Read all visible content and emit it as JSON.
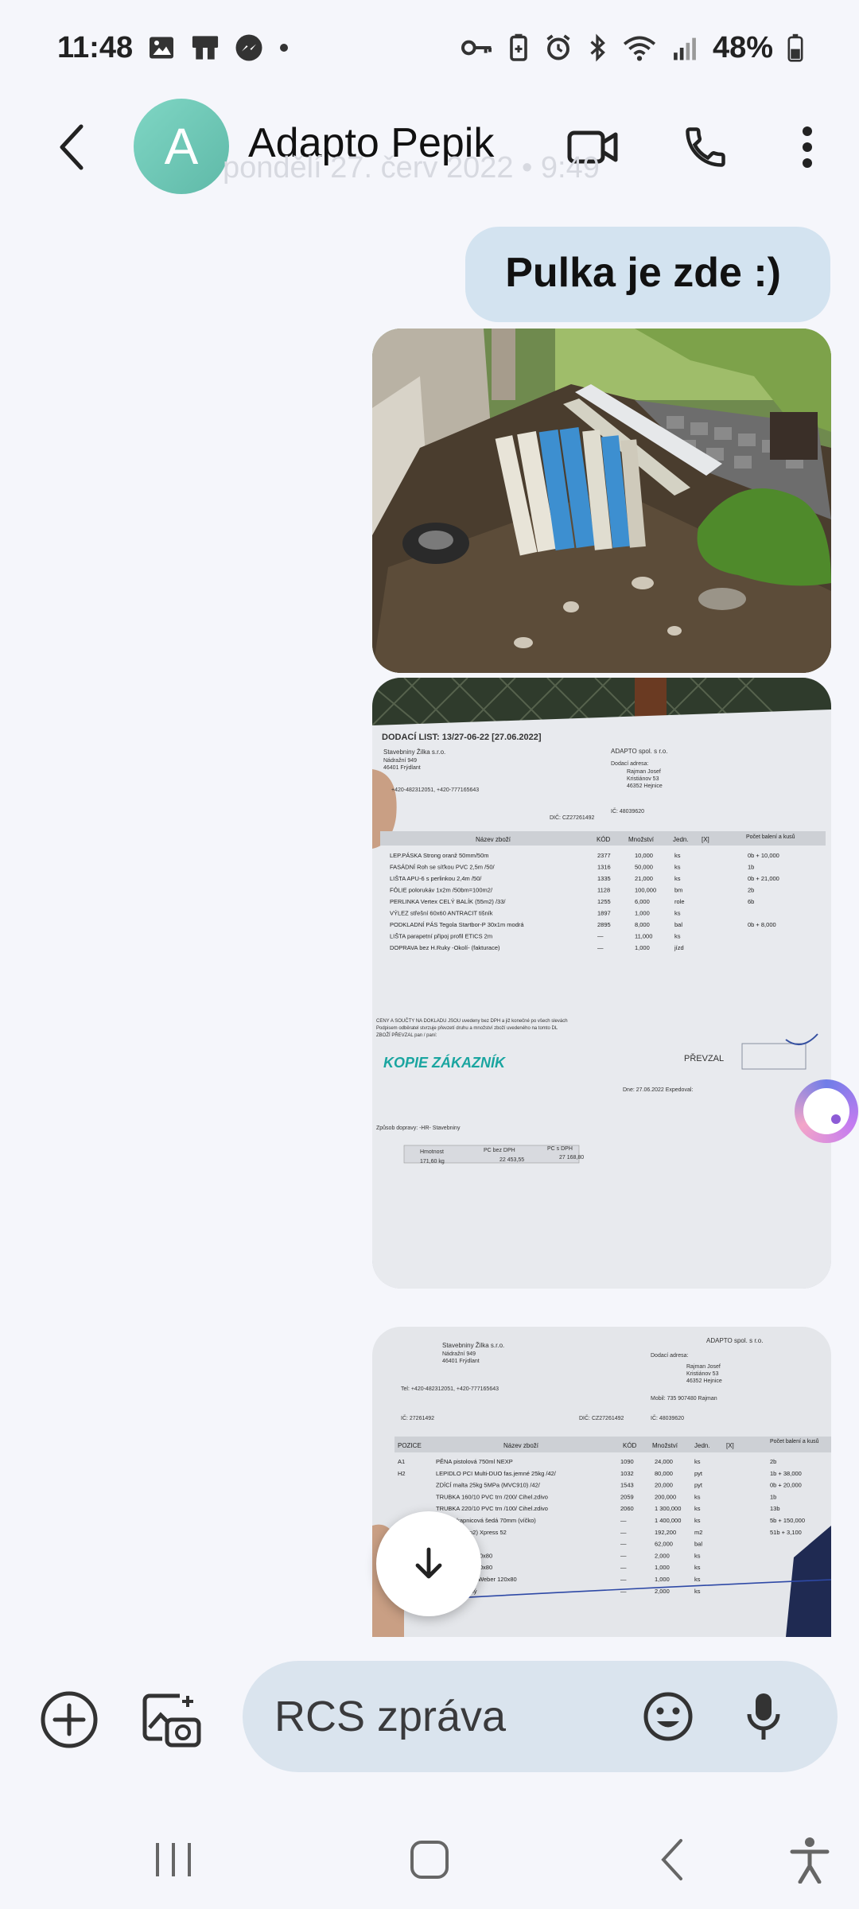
{
  "status_bar": {
    "time": "11:48",
    "battery": "48%",
    "left_icons": [
      "gallery-icon",
      "cast-icon",
      "messenger-icon",
      "dot-icon"
    ],
    "right_icons": [
      "key-icon",
      "battery-saver-icon",
      "alarm-icon",
      "bluetooth-icon",
      "wifi-icon",
      "signal-icon",
      "battery-icon"
    ]
  },
  "header": {
    "avatar_letter": "A",
    "contact_name": "Adapto Pepik",
    "date_ghost": "pondělí 27. červ 2022 • 9:49"
  },
  "messages": [
    {
      "type": "text",
      "direction": "outgoing",
      "text": "Pulka je zde :)"
    }
  ],
  "photos": {
    "photo2": {
      "doc_title": "DODACÍ LIST: 13/27-06-22   [27.06.2022]",
      "supplier": "Stavebniny Žilka s.r.o.",
      "supplier_addr1": "Nádražní 949",
      "supplier_addr2": "46401 Frýdlant",
      "phone": "+420-482312051, +420-777165643",
      "recipient": "ADAPTO spol. s r.o.",
      "delivery_label": "Dodací adresa:",
      "delivery_name": "Rajman Josef",
      "delivery_street": "Kristiánov 53",
      "delivery_city": "46352 Hejnice",
      "dic": "DIČ: CZ27261492",
      "ico": "IČ: 48039620",
      "col_name": "Název zboží",
      "col_code": "KÓD",
      "col_qty": "Množství",
      "col_unit": "Jedn.",
      "col_check": "[X]",
      "col_count": "Počet balení a kusů",
      "rows": [
        {
          "name": "LEP.PÁSKA Strong oranž 50mm/50m",
          "code": "2377",
          "qty": "10,000",
          "unit": "ks",
          "count": "0b + 10,000"
        },
        {
          "name": "FASÁDNÍ Roh se síťkou PVC 2,5m /50/",
          "code": "1316",
          "qty": "50,000",
          "unit": "ks",
          "count": "1b"
        },
        {
          "name": "LIŠTA APU-6 s perlinkou 2,4m /50/",
          "code": "1335",
          "qty": "21,000",
          "unit": "ks",
          "count": "0b + 21,000"
        },
        {
          "name": "FÓLIE polorukáv 1x2m /50bm=100m2/",
          "code": "1128",
          "qty": "100,000",
          "unit": "bm",
          "count": "2b"
        },
        {
          "name": "PERLINKA Vertex CELÝ BALÍK (55m2) /33/",
          "code": "1255",
          "qty": "6,000",
          "unit": "role",
          "count": "6b"
        },
        {
          "name": "VÝLEZ střešní 60x60 ANTRACIT tišník",
          "code": "1897",
          "qty": "1,000",
          "unit": "ks",
          "count": ""
        },
        {
          "name": "PODKLADNÍ PÁS Tegola Startbor-P 30x1m modrá",
          "code": "2895",
          "qty": "8,000",
          "unit": "bal",
          "count": "0b + 8,000"
        },
        {
          "name": "LIŠTA parapetní připoj profil ETICS 2m",
          "code": "—",
          "qty": "11,000",
          "unit": "ks",
          "count": ""
        },
        {
          "name": "DOPRAVA bez H.Ruky -Okolí- (fakturace)",
          "code": "—",
          "qty": "1,000",
          "unit": "jízd",
          "count": ""
        }
      ],
      "note1": "CENY A SOUČTY NA DOKLADU JSOU uvedeny bez DPH a již konečné po všech slevách",
      "note2": "Podpisem odběratel stvrzuje převzetí druhu a množství zboží uvedeného na tomto DL",
      "note3": "ZBOŽÍ PŘEVZAL pan / paní:",
      "stamp": "KOPIE ZÁKAZNÍK",
      "received": "PŘEVZAL",
      "date_line": "Dne: 27.06.2022   Expedoval:",
      "transport": "Způsob dopravy:  -HR- Stavebniny",
      "weight_label": "Hmotnost",
      "price_no_vat_label": "PC bez DPH",
      "price_vat_label": "PC s DPH",
      "weight": "171,60 kg",
      "price_no_vat": "22 453,55",
      "price_vat": "27 168,80"
    },
    "photo3": {
      "supplier": "Stavebniny Žilka s.r.o.",
      "supplier_addr1": "Nádražní 949",
      "supplier_addr2": "46401 Frýdlant",
      "recipient": "ADAPTO spol. s r.o.",
      "delivery_label": "Dodací adresa:",
      "delivery_name": "Rajman Josef",
      "delivery_street": "Kristiánov 53",
      "delivery_city": "46352 Hejnice",
      "mobil": "Mobil: 735 907480 Rajman",
      "phone": "Tel: +420-482312051, +420-777165643",
      "ico_left": "IČ: 27261492",
      "dic": "DIČ: CZ27261492",
      "ico_right": "IČ: 48039620",
      "col_pos": "POZICE",
      "col_name": "Název zboží",
      "col_code": "KÓD",
      "col_qty": "Množství",
      "col_unit": "Jedn.",
      "col_check": "[X]",
      "col_count": "Počet balení a kusů",
      "rows": [
        {
          "pos": "A1",
          "name": "PĚNA pistolová 750ml NEXP",
          "code": "1090",
          "qty": "24,000",
          "unit": "ks",
          "count": "2b"
        },
        {
          "pos": "H2",
          "name": "LEPIDLO PCI Multi-DUO fas.jemné 25kg /42/",
          "code": "1032",
          "qty": "80,000",
          "unit": "pyt",
          "count": "1b + 38,000"
        },
        {
          "pos": "",
          "name": "ZDÍCÍ malta 25kg 5MPa (MVC910) /42/",
          "code": "1543",
          "qty": "20,000",
          "unit": "pyt",
          "count": "0b + 20,000"
        },
        {
          "pos": "",
          "name": "TRUBKA 160/10 PVC trn /200/ Cihel.zdivo",
          "code": "2059",
          "qty": "200,000",
          "unit": "ks",
          "count": "1b"
        },
        {
          "pos": "",
          "name": "TRUBKA 220/10 PVC trn /100/ Cihel.zdivo",
          "code": "2060",
          "qty": "1 300,000",
          "unit": "ks",
          "count": "13b"
        },
        {
          "pos": "",
          "name": "LIŠTA okapnicová šedá 70mm (víčko)",
          "code": "—",
          "qty": "1 400,000",
          "unit": "ks",
          "count": "5b + 150,000"
        },
        {
          "pos": "",
          "name": "DESKA (3,1m2) Xpress 52",
          "code": "—",
          "qty": "192,200",
          "unit": "m2",
          "count": "51b + 3,100"
        },
        {
          "pos": "",
          "name": "DLAŽBA zbývá",
          "code": "—",
          "qty": "62,000",
          "unit": "bal",
          "count": ""
        },
        {
          "pos": "",
          "name": "ROŠT EURO 120x80",
          "code": "—",
          "qty": "2,000",
          "unit": "ks",
          "count": ""
        },
        {
          "pos": "",
          "name": "ROŠT EURO 120x80",
          "code": "—",
          "qty": "1,000",
          "unit": "ks",
          "count": ""
        },
        {
          "pos": "",
          "name": "PALETA EURO Weber 120x80",
          "code": "—",
          "qty": "1,000",
          "unit": "ks",
          "count": ""
        },
        {
          "pos": "",
          "name": "ROŠT nevratný",
          "code": "—",
          "qty": "2,000",
          "unit": "ks",
          "count": ""
        }
      ]
    }
  },
  "composer": {
    "placeholder": "RCS zpráva"
  },
  "colors": {
    "background": "#f5f6fb",
    "bubble_outgoing": "#d3e3f0",
    "avatar": "#6fc8b6",
    "input_bg": "#dae4ee"
  }
}
